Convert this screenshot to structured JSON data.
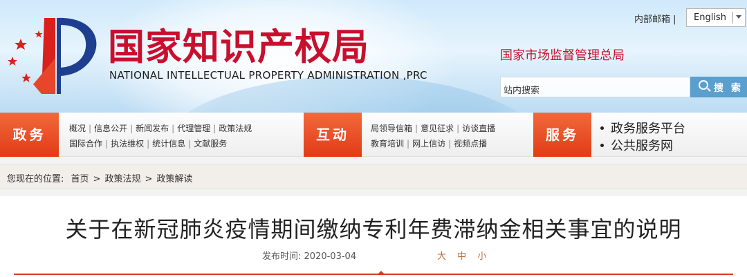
{
  "header": {
    "logo_cn": "国家知识产权局",
    "logo_en": "NATIONAL INTELLECTUAL PROPERTY ADMINISTRATION ,PRC",
    "mail_link": "内部邮箱 |",
    "language": "English",
    "samr_link": "国家市场监督管理总局",
    "search_placeholder": "站内搜索",
    "search_button": "搜 索",
    "brand_color": "#c8102e"
  },
  "nav": {
    "zhengwu": {
      "label": "政务",
      "row1": [
        "概况",
        "信息公开",
        "新闻发布",
        "代理管理",
        "政策法规"
      ],
      "row2": [
        "国际合作",
        "执法维权",
        "统计信息",
        "文献服务"
      ]
    },
    "hudong": {
      "label": "互动",
      "row1": [
        "局领导信箱",
        "意见征求",
        "访谈直播"
      ],
      "row2": [
        "教育培训",
        "网上信访",
        "视频点播"
      ]
    },
    "fuwu": {
      "label": "服务",
      "items": [
        "政务服务平台",
        "公共服务网"
      ]
    },
    "accent_color": "#e23a17"
  },
  "breadcrumb": {
    "prefix": "您现在的位置:",
    "items": [
      "首页",
      ">",
      "政策法规",
      ">",
      "政策解读"
    ]
  },
  "article": {
    "title": "关于在新冠肺炎疫情期间缴纳专利年费滞纳金相关事宜的说明",
    "date_label": "发布时间:",
    "date": "2020-03-04",
    "font_sizes": [
      "大",
      "中",
      "小"
    ]
  }
}
